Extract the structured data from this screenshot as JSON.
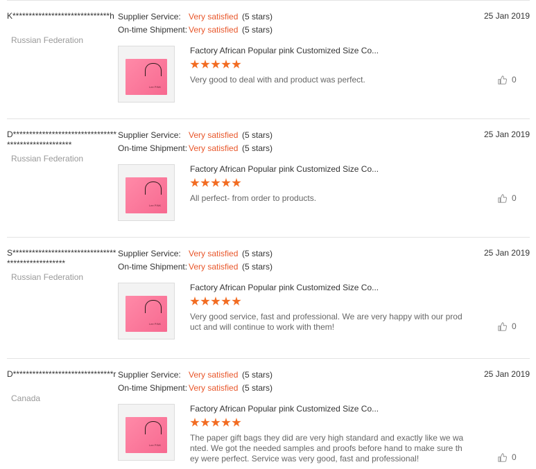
{
  "colors": {
    "accent": "#e8562a",
    "star": "#f26c22",
    "divider": "#e3e3e3"
  },
  "labels": {
    "supplier_service": "Supplier Service:",
    "ontime_shipment": "On-time Shipment:"
  },
  "reviews": [
    {
      "buyer": "K******************************h",
      "country": "Russian Federation",
      "supplier_rating": "Very satisfied",
      "supplier_stars": "(5 stars)",
      "shipment_rating": "Very satisfied",
      "shipment_stars": "(5 stars)",
      "date": "25 Jan 2019",
      "product_title": "Factory African Popular pink Customized Size Co...",
      "product_rating": 5,
      "feedback": "Very good to deal with and product was perfect.",
      "likes": "0",
      "image_logo": "Lee PINK"
    },
    {
      "buyer": "D****************************************************",
      "country": "Russian Federation",
      "supplier_rating": "Very satisfied",
      "supplier_stars": "(5 stars)",
      "shipment_rating": "Very satisfied",
      "shipment_stars": "(5 stars)",
      "date": "25 Jan 2019",
      "product_title": "Factory African Popular pink Customized Size Co...",
      "product_rating": 5,
      "feedback": "All perfect- from order to products.",
      "likes": "0",
      "image_logo": "Lee PINK"
    },
    {
      "buyer": "S**************************************************",
      "country": "Russian Federation",
      "supplier_rating": "Very satisfied",
      "supplier_stars": "(5 stars)",
      "shipment_rating": "Very satisfied",
      "shipment_stars": "(5 stars)",
      "date": "25 Jan 2019",
      "product_title": "Factory African Popular pink Customized Size Co...",
      "product_rating": 5,
      "feedback": "Very good service, fast and professional. We are very happy with our product and will continue to work with them!",
      "likes": "0",
      "image_logo": "Lee PINK"
    },
    {
      "buyer": "D*******************************r",
      "country": "Canada",
      "supplier_rating": "Very satisfied",
      "supplier_stars": "(5 stars)",
      "shipment_rating": "Very satisfied",
      "shipment_stars": "(5 stars)",
      "date": "25 Jan 2019",
      "product_title": "Factory African Popular pink Customized Size Co...",
      "product_rating": 5,
      "feedback": "The paper gift bags they did are very high standard and exactly like we wanted. We got the needed samples and proofs before hand to make sure they were perfect. Service was very good, fast and professional!",
      "likes": "0",
      "image_logo": "Lee PINK"
    }
  ]
}
